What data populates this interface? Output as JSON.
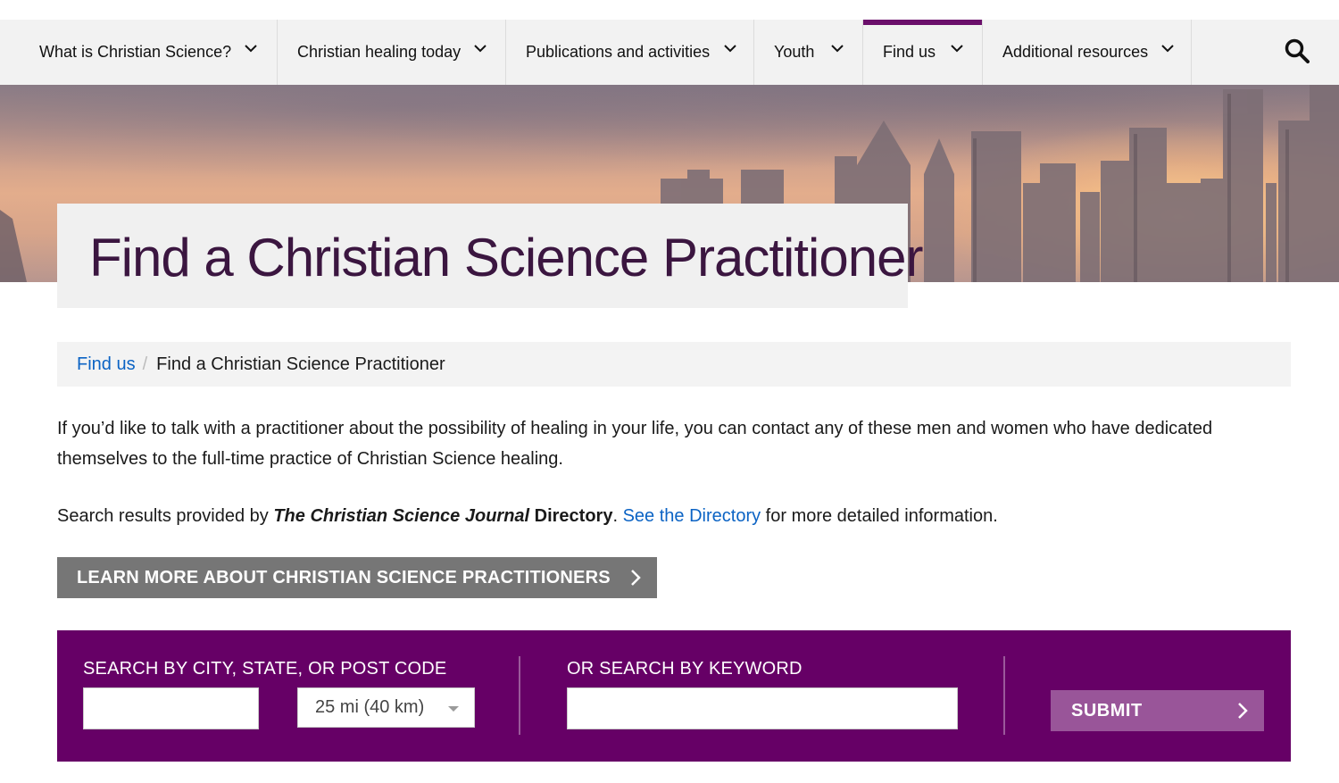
{
  "nav": {
    "items": [
      {
        "label": "What is Christian Science?",
        "icon": "chevron-down-icon",
        "active": false
      },
      {
        "label": "Christian healing today",
        "icon": "chevron-down-icon",
        "active": false
      },
      {
        "label": "Publications and activities",
        "icon": "chevron-down-icon",
        "active": false
      },
      {
        "label": "Youth",
        "icon": "chevron-down-icon",
        "active": false
      },
      {
        "label": "Find us",
        "icon": "chevron-down-icon",
        "active": true
      },
      {
        "label": "Additional resources",
        "icon": "chevron-down-icon",
        "active": false
      }
    ],
    "search_icon": "search-icon",
    "accent_color": "#6b0f6b"
  },
  "hero": {
    "title": "Find a Christian Science Practitioner"
  },
  "breadcrumb": {
    "link": "Find us",
    "separator": "/",
    "current": "Find a Christian Science Practitioner"
  },
  "intro": {
    "text": "If you’d like to talk with a practitioner about the possibility of healing in your life, you can contact any of these men and women who have dedicated themselves to the full-time practice of Christian Science healing."
  },
  "results_note": {
    "prefix": "Search results provided by ",
    "journal": "The Christian Science Journal",
    "directory": " Directory",
    "period": ". ",
    "link": "See the Directory",
    "suffix": " for more detailed information."
  },
  "learn_more": {
    "label": "LEARN MORE ABOUT CHRISTIAN SCIENCE PRACTITIONERS",
    "icon": "chevron-right-icon"
  },
  "search_panel": {
    "location_label": "SEARCH BY CITY, STATE, OR POST CODE",
    "location_value": "",
    "radius_value": "25 mi (40 km)",
    "keyword_label": "OR SEARCH BY KEYWORD",
    "keyword_value": "",
    "submit_label": "SUBMIT",
    "panel_color": "#660066",
    "submit_color": "#995599"
  }
}
